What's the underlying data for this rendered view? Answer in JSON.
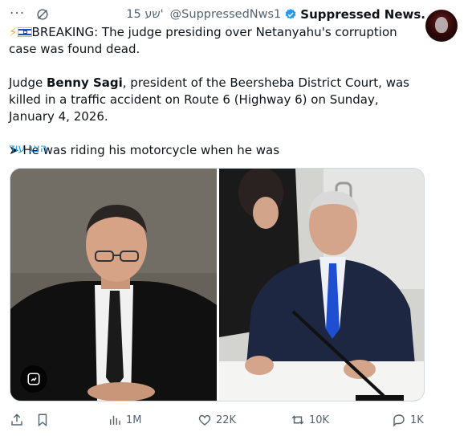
{
  "header": {
    "more_glyph": "···",
    "time": "15 שע'",
    "handle": "@SuppressedNws1",
    "display_name": "Suppressed News."
  },
  "body": {
    "line1_prefix_icons": [
      "lightning-icon",
      "israel-flag-icon"
    ],
    "line1": "BREAKING: The judge presiding over Netanyahu's corruption case was found dead.",
    "p2_before": "Judge ",
    "p2_bold": "Benny Sagi",
    "p2_after": ", president of the Beersheba District Court, was killed in a traffic accident on Route 6 (Highway 6) on Sunday, January 4, 2026.",
    "p3_arrow": "➤",
    "p3": " He was riding his motorcycle when he was",
    "show_more": "הצג עוד"
  },
  "media": {
    "icons": [
      "alt-text-icon"
    ]
  },
  "actions": {
    "views": "1M",
    "likes": "22K",
    "reposts": "10K",
    "replies": "1K"
  },
  "colors": {
    "accent": "#1d9bf0",
    "muted": "#536471",
    "text": "#0f1419"
  }
}
